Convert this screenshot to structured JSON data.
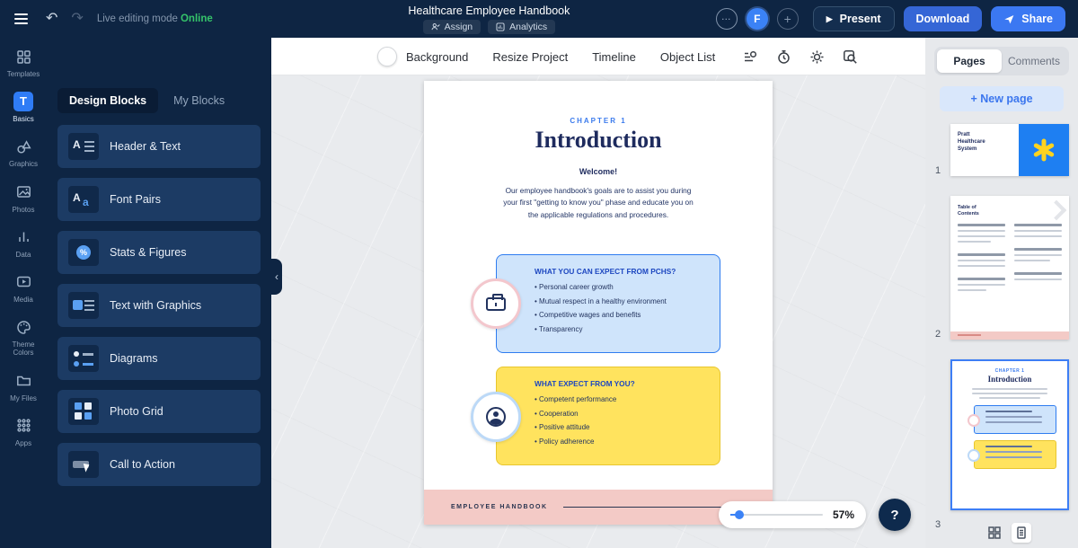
{
  "topbar": {
    "live_label": "Live editing mode",
    "online_label": "Online",
    "title": "Healthcare Employee Handbook",
    "assign_label": "Assign",
    "analytics_label": "Analytics",
    "avatar_initial": "F",
    "present_label": "Present",
    "download_label": "Download",
    "share_label": "Share"
  },
  "rail": {
    "items": [
      {
        "label": "Templates"
      },
      {
        "label": "Basics"
      },
      {
        "label": "Graphics"
      },
      {
        "label": "Photos"
      },
      {
        "label": "Data"
      },
      {
        "label": "Media"
      },
      {
        "label": "Theme Colors"
      },
      {
        "label": "My Files"
      },
      {
        "label": "Apps"
      }
    ]
  },
  "panel": {
    "tabs": [
      {
        "label": "Design Blocks"
      },
      {
        "label": "My Blocks"
      }
    ],
    "blocks": [
      {
        "label": "Header & Text"
      },
      {
        "label": "Font Pairs"
      },
      {
        "label": "Stats & Figures"
      },
      {
        "label": "Text with Graphics"
      },
      {
        "label": "Diagrams"
      },
      {
        "label": "Photo Grid"
      },
      {
        "label": "Call to Action"
      }
    ]
  },
  "toolbar": {
    "background_label": "Background",
    "resize_label": "Resize Project",
    "timeline_label": "Timeline",
    "object_list_label": "Object List"
  },
  "page": {
    "chapter": "CHAPTER 1",
    "title": "Introduction",
    "welcome": "Welcome!",
    "intro_paragraph": "Our employee handbook's goals are to assist you during\nyour first \"getting to know you\" phase and educate you on\nthe applicable regulations and procedures.",
    "blue_box": {
      "title": "WHAT YOU CAN EXPECT FROM PCHS?",
      "items": [
        "Personal career growth",
        "Mutual respect in a healthy environment",
        "Competitive wages and benefits",
        "Transparency"
      ]
    },
    "yellow_box": {
      "title": "WHAT EXPECT FROM YOU?",
      "items": [
        "Competent performance",
        "Cooperation",
        "Positive attitude",
        "Policy adherence"
      ]
    },
    "footer_label": "EMPLOYEE HANDBOOK"
  },
  "canvas_controls": {
    "zoom_value": "57%",
    "help_label": "?"
  },
  "right_panel": {
    "tabs": [
      {
        "label": "Pages"
      },
      {
        "label": "Comments"
      }
    ],
    "new_page_label": "+ New page",
    "pages": [
      {
        "number": "1",
        "line1": "Pratt",
        "line2": "Healthcare",
        "line3": "System"
      },
      {
        "number": "2",
        "title": "Table of Contents"
      },
      {
        "number": "3",
        "chapter": "CHAPTER 1",
        "title": "Introduction"
      }
    ]
  },
  "colors": {
    "accent_blue": "#3b78f2",
    "navy": "#0e2543",
    "online_green": "#35c46a",
    "box_blue": "#cfe4fb",
    "box_yellow": "#ffe35e",
    "strip_pink": "#f3cac6"
  }
}
